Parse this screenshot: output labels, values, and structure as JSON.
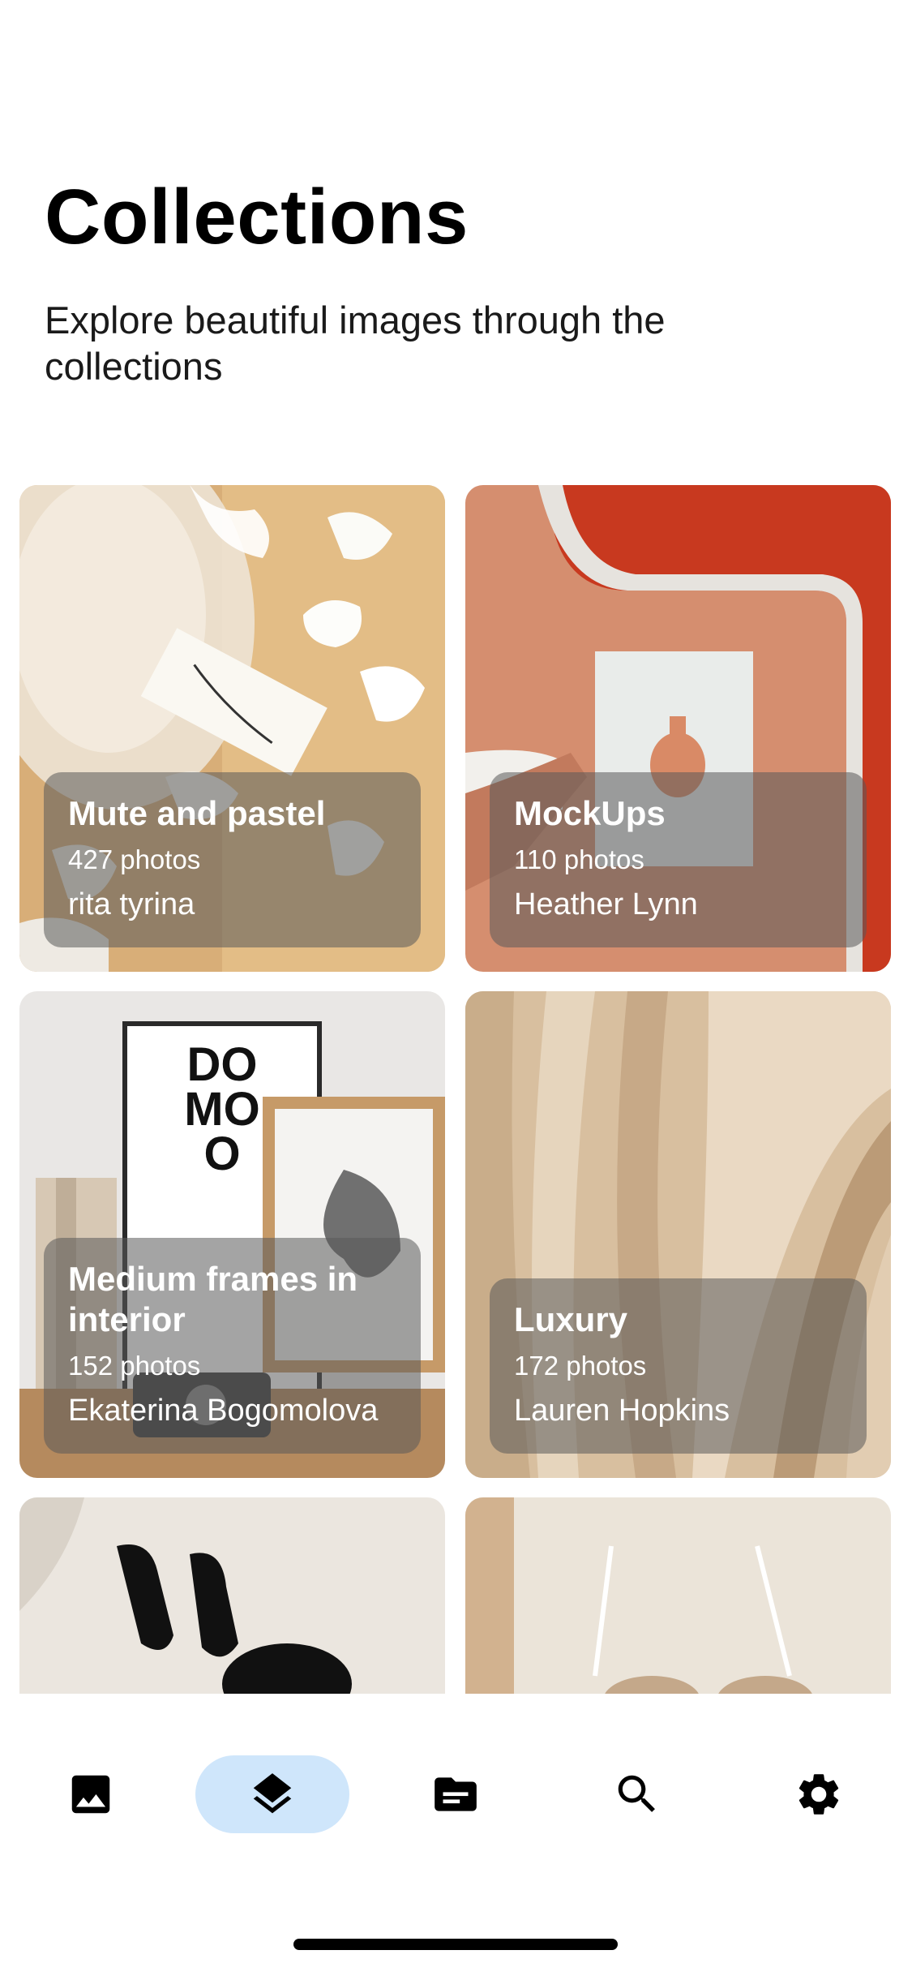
{
  "header": {
    "title": "Collections",
    "subtitle": "Explore beautiful images through the collections"
  },
  "collections": [
    {
      "name": "Mute and pastel",
      "count": "427 photos",
      "author": "rita tyrina",
      "palette": [
        "#e7c79b",
        "#f3efe7",
        "#b8875a"
      ]
    },
    {
      "name": "MockUps",
      "count": "110 photos",
      "author": "Heather Lynn",
      "palette": [
        "#d99474",
        "#c8391f",
        "#f0f0ee"
      ]
    },
    {
      "name": "Medium frames in interior",
      "count": "152 photos",
      "author": "Ekaterina Bogomolova",
      "palette": [
        "#ecebea",
        "#c08c5b",
        "#111111"
      ]
    },
    {
      "name": "Luxury",
      "count": "172 photos",
      "author": "Lauren Hopkins",
      "palette": [
        "#dcc4a4",
        "#bfa07e",
        "#f1e3cf"
      ]
    },
    {
      "name": "",
      "count": "",
      "author": "",
      "palette": [
        "#e9e4dc",
        "#111111"
      ]
    },
    {
      "name": "",
      "count": "",
      "author": "",
      "palette": [
        "#e8e0d5",
        "#c8a583"
      ]
    }
  ],
  "bottom_nav": {
    "items": [
      {
        "icon": "image-icon",
        "active": false
      },
      {
        "icon": "layers-icon",
        "active": true
      },
      {
        "icon": "article-icon",
        "active": false
      },
      {
        "icon": "search-icon",
        "active": false
      },
      {
        "icon": "settings-icon",
        "active": false
      }
    ],
    "active_color": "#cfe6fb"
  }
}
